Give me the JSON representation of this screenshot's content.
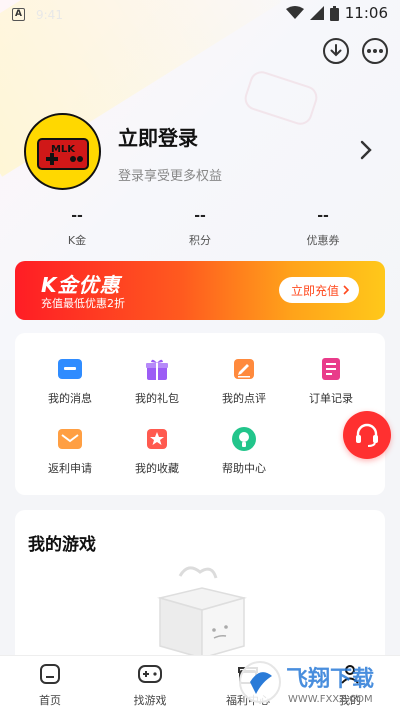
{
  "status_bar": {
    "time": "11:06",
    "left_badge": "A",
    "faded_time": "9:41"
  },
  "header": {
    "download_icon": "download-icon",
    "more_icon": "more-icon"
  },
  "profile": {
    "title": "立即登录",
    "subtitle": "登录享受更多权益",
    "avatar_icon": "game-controller-logo"
  },
  "stats": [
    {
      "value": "--",
      "label": "K金"
    },
    {
      "value": "--",
      "label": "积分"
    },
    {
      "value": "--",
      "label": "优惠券"
    }
  ],
  "banner": {
    "title": "K金优惠",
    "subtitle": "充值最低优惠2折",
    "button": "立即充值"
  },
  "menu": [
    {
      "label": "我的消息",
      "icon": "message-icon",
      "color": "#2f8cff"
    },
    {
      "label": "我的礼包",
      "icon": "gift-icon",
      "color": "#9c5cf5"
    },
    {
      "label": "我的点评",
      "icon": "review-icon",
      "color": "#ff8a3d"
    },
    {
      "label": "订单记录",
      "icon": "order-icon",
      "color": "#e93b8a"
    },
    {
      "label": "返利申请",
      "icon": "rebate-icon",
      "color": "#ff9f43"
    },
    {
      "label": "我的收藏",
      "icon": "favorite-icon",
      "color": "#ff5a4f"
    },
    {
      "label": "帮助中心",
      "icon": "help-icon",
      "color": "#22c58b"
    }
  ],
  "games": {
    "title": "我的游戏"
  },
  "tabs": [
    {
      "label": "首页",
      "icon": "home-icon"
    },
    {
      "label": "找游戏",
      "icon": "gamepad-icon"
    },
    {
      "label": "福利中心",
      "icon": "gift-icon"
    },
    {
      "label": "我的",
      "icon": "profile-icon"
    }
  ],
  "watermark": {
    "text": "飞翔下载",
    "url": "WWW.FXXZ.COM"
  },
  "colors": {
    "accent": "#ff3030",
    "banner_start": "#ff1d25",
    "banner_end": "#ffc81a"
  }
}
